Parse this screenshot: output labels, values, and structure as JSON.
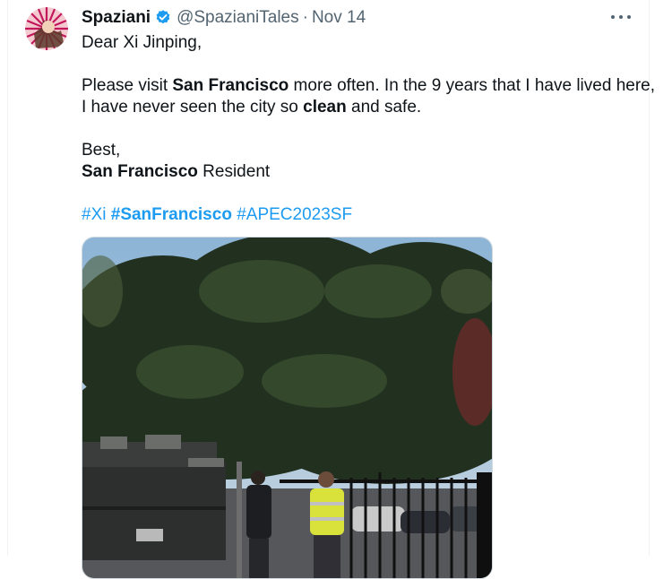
{
  "tweet": {
    "author_name": "Spaziani",
    "handle": "@SpazianiTales",
    "separator": "·",
    "date": "Nov 14",
    "greeting": "Dear Xi Jinping,",
    "p1_pre": "Please visit ",
    "p1_bold": "San Francisco",
    "p1_post": " more often. In the 9 years that I have lived here,",
    "p2_pre": "I have never seen the city so ",
    "p2_bold": "clean",
    "p2_post": " and safe.",
    "signoff": "Best,",
    "sig_bold": "San Francisco",
    "sig_post": " Resident",
    "hashtags": [
      {
        "text": "#Xi",
        "bold": false
      },
      {
        "text": "#SanFrancisco",
        "bold": true
      },
      {
        "text": "#APEC2023SF",
        "bold": false
      }
    ]
  },
  "colors": {
    "link": "#1d9bf0",
    "secondary": "#536471",
    "verified": "#1d9bf0"
  },
  "icons": {
    "verified": "verified-badge-icon",
    "more": "more-dots-icon"
  }
}
